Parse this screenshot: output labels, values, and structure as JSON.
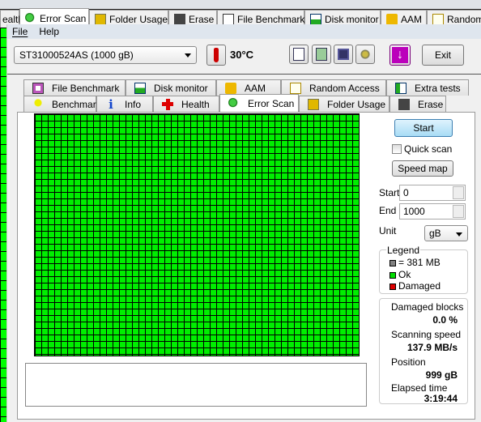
{
  "background_tabs": [
    {
      "label": "ealth",
      "icon": "health-cross-icon",
      "active": false
    },
    {
      "label": "Error Scan",
      "icon": "magnifier-icon",
      "active": true
    },
    {
      "label": "Folder Usage",
      "icon": "folder-icon",
      "active": false
    },
    {
      "label": "Erase",
      "icon": "trash-icon",
      "active": false
    },
    {
      "label": "File Benchmark",
      "icon": "file-benchmark-icon",
      "active": false
    },
    {
      "label": "Disk monitor",
      "icon": "disk-monitor-icon",
      "active": false
    },
    {
      "label": "AAM",
      "icon": "speaker-icon",
      "active": false
    },
    {
      "label": "Random",
      "icon": "random-access-icon",
      "active": false
    }
  ],
  "menu": {
    "file": "File",
    "help": "Help"
  },
  "toolbar": {
    "drive": "ST31000524AS (1000 gB)",
    "temperature": "30°C",
    "exit_label": "Exit"
  },
  "tabs_row1": [
    {
      "label": "File Benchmark",
      "icon": "file-benchmark-icon"
    },
    {
      "label": "Disk monitor",
      "icon": "disk-monitor-icon"
    },
    {
      "label": "AAM",
      "icon": "speaker-icon"
    },
    {
      "label": "Random Access",
      "icon": "random-access-icon"
    },
    {
      "label": "Extra tests",
      "icon": "extra-tests-icon"
    }
  ],
  "tabs_row2": [
    {
      "label": "Benchmark",
      "icon": "lightbulb-icon"
    },
    {
      "label": "Info",
      "icon": "info-icon"
    },
    {
      "label": "Health",
      "icon": "health-cross-icon"
    },
    {
      "label": "Error Scan",
      "icon": "magnifier-icon",
      "active": true
    },
    {
      "label": "Folder Usage",
      "icon": "folder-icon"
    },
    {
      "label": "Erase",
      "icon": "trash-icon"
    }
  ],
  "scan": {
    "start_button": "Start",
    "quick_scan_label": "Quick scan",
    "quick_scan_checked": false,
    "speed_map_button": "Speed map",
    "start_label": "Start",
    "start_value": "0",
    "end_label": "End",
    "end_value": "1000",
    "unit_label": "Unit",
    "unit_value": "gB",
    "legend_title": "Legend",
    "legend": [
      {
        "label": "= 381 MB",
        "color": "#808080"
      },
      {
        "label": "Ok",
        "color": "#00dd00"
      },
      {
        "label": "Damaged",
        "color": "#dd0000"
      }
    ],
    "damaged_blocks_label": "Damaged blocks",
    "damaged_blocks_value": "0.0 %",
    "scanning_speed_label": "Scanning speed",
    "scanning_speed_value": "137.9 MB/s",
    "position_label": "Position",
    "position_value": "999 gB",
    "elapsed_label": "Elapsed time",
    "elapsed_value": "3:19:44"
  }
}
